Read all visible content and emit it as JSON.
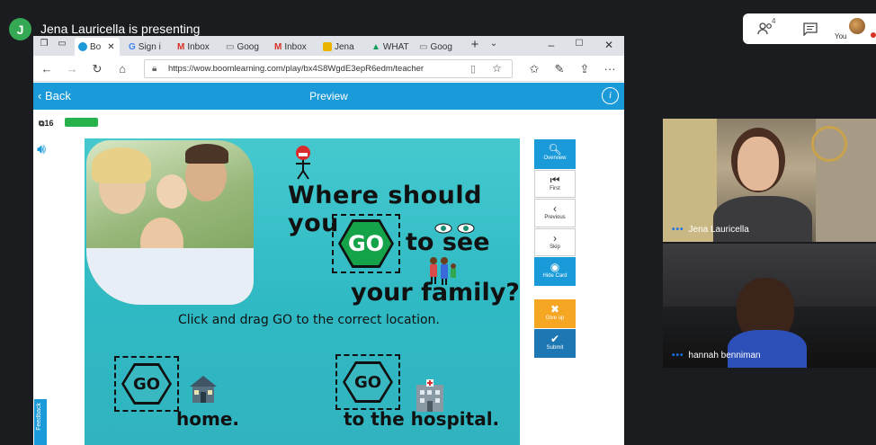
{
  "meet": {
    "presenter_initial": "J",
    "presenter_text": "Jena Lauricella is presenting",
    "people_count": "4",
    "you_label": "You"
  },
  "browser": {
    "tabs": [
      {
        "label": "Bo",
        "favicon": "boom-icon",
        "color": "#1a9ad9",
        "active": true
      },
      {
        "label": "Sign i",
        "favicon": "google-icon",
        "color": "#4285f4"
      },
      {
        "label": "Inbox",
        "favicon": "gmail-icon",
        "color": "#d93025"
      },
      {
        "label": "Goog",
        "favicon": "page-icon",
        "color": "#666666"
      },
      {
        "label": "Inbox",
        "favicon": "gmail-icon",
        "color": "#d93025"
      },
      {
        "label": "Jena",
        "favicon": "photo-icon",
        "color": "#e8b400"
      },
      {
        "label": "WHAT",
        "favicon": "drive-icon",
        "color": "#0f9d58"
      },
      {
        "label": "Goog",
        "favicon": "page-icon",
        "color": "#666666"
      }
    ],
    "url": "https://wow.boomlearning.com/play/bx4S8WgdE3epR6edm/teacher"
  },
  "boom": {
    "back_label": "Back",
    "title": "Preview",
    "card_count": "16",
    "progress_fraction": 1.0,
    "feedback_label": "Feedback"
  },
  "card": {
    "question_line1": "Where should you",
    "question_line2": "to see",
    "question_line3": "your family?",
    "go_text": "GO",
    "instruction": "Click and drag GO to the correct location.",
    "dest_home": "home.",
    "dest_hospital": "to the hospital."
  },
  "side_buttons": {
    "overview": "Overview",
    "first": "First",
    "previous": "Previous",
    "skip": "Skip",
    "hide_card": "Hide Card",
    "give_up": "Give up",
    "submit": "Submit"
  },
  "participants": [
    {
      "name": "Jena Lauricella"
    },
    {
      "name": "hannah benniman"
    }
  ],
  "colors": {
    "boom_blue": "#1a9ad9",
    "go_green": "#15a34a",
    "card_teal": "#3ab8c2",
    "give_up_orange": "#f5a623"
  }
}
